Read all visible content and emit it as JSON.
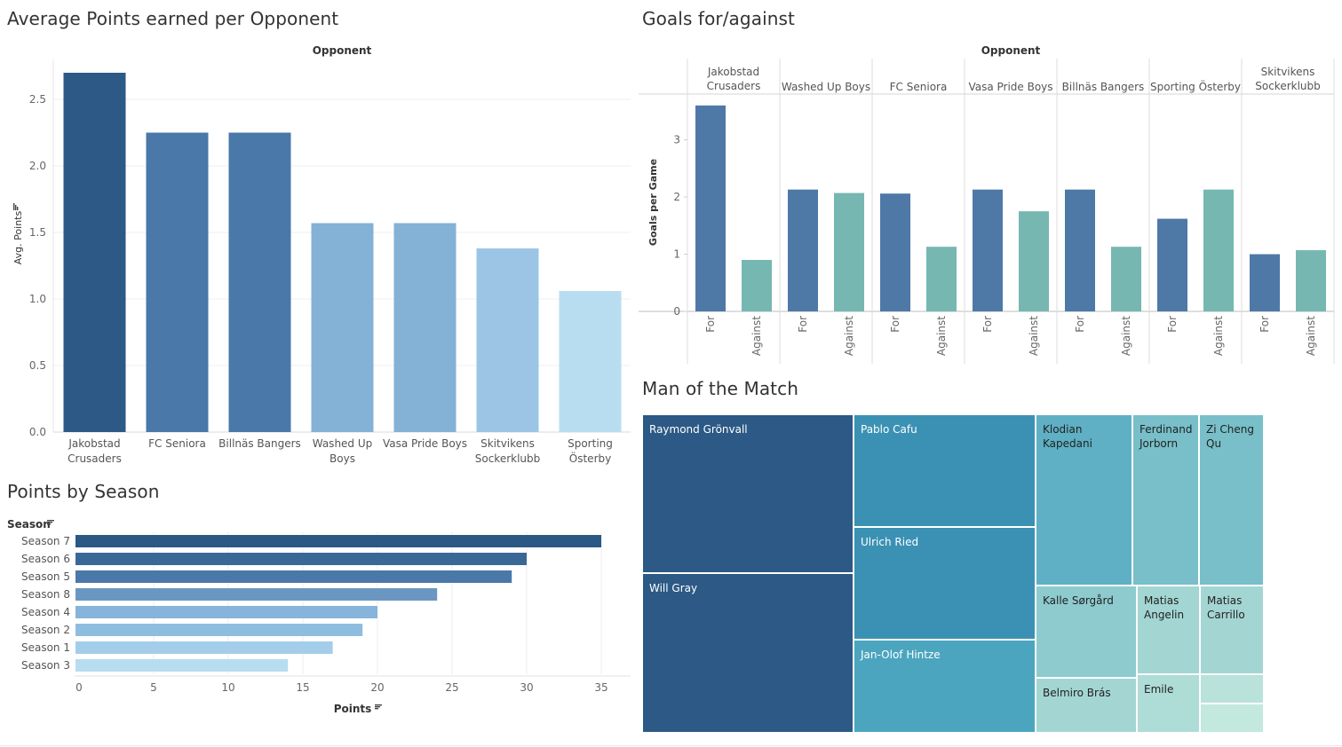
{
  "titles": {
    "avg_points": "Average Points earned per Opponent",
    "goals": "Goals for/against",
    "season": "Points by Season",
    "motm": "Man of the Match"
  },
  "icons": {
    "sort": "sort-descending-icon"
  },
  "chart_data": [
    {
      "type": "bar",
      "name": "avg-points",
      "header": "Opponent",
      "ylabel": "Avg. Points",
      "categories": [
        [
          "Jakobstad",
          "Crusaders"
        ],
        [
          "FC Seniora"
        ],
        [
          "Billnäs Bangers"
        ],
        [
          "Washed Up",
          "Boys"
        ],
        [
          "Vasa Pride Boys"
        ],
        [
          "Skitvikens",
          "Sockerklubb"
        ],
        [
          "Sporting",
          "Österby"
        ]
      ],
      "values": [
        2.7,
        2.25,
        2.25,
        1.57,
        1.57,
        1.38,
        1.06
      ],
      "colors": [
        "#2c5985",
        "#4a78a8",
        "#4a78a8",
        "#84b1d6",
        "#84b1d6",
        "#9cc5e5",
        "#b9ddf0"
      ],
      "ylim": [
        0,
        2.8
      ],
      "yticks": [
        "0.0",
        "0.5",
        "1.0",
        "1.5",
        "2.0",
        "2.5"
      ]
    },
    {
      "type": "bar",
      "name": "goals-for-against",
      "header": "Opponent",
      "ylabel": "Goals per Game",
      "groups": [
        [
          "Jakobstad",
          "Crusaders"
        ],
        [
          "Washed Up Boys"
        ],
        [
          "FC Seniora"
        ],
        [
          "Vasa Pride Boys"
        ],
        [
          "Billnäs Bangers"
        ],
        [
          "Sporting Österby"
        ],
        [
          "Skitvikens",
          "Sockerklubb"
        ]
      ],
      "bar_labels": [
        "For",
        "Against"
      ],
      "series": [
        {
          "name": "For",
          "color": "#4e79a7",
          "values": [
            3.6,
            2.13,
            2.06,
            2.13,
            2.13,
            1.62,
            1.0
          ]
        },
        {
          "name": "Against",
          "color": "#76b7b2",
          "values": [
            0.9,
            2.07,
            1.13,
            1.75,
            1.13,
            2.13,
            1.07
          ]
        }
      ],
      "ylim": [
        0,
        3.8
      ],
      "yticks": [
        "0",
        "1",
        "2",
        "3"
      ]
    },
    {
      "type": "bar",
      "name": "points-by-season",
      "orientation": "horizontal",
      "ylabel": "Season",
      "xlabel": "Points",
      "categories": [
        "Season 7",
        "Season 6",
        "Season 5",
        "Season 8",
        "Season 4",
        "Season 2",
        "Season 1",
        "Season 3"
      ],
      "values": [
        35,
        30,
        29,
        24,
        20,
        19,
        17,
        14
      ],
      "colors": [
        "#2b5884",
        "#3a6896",
        "#4a78a8",
        "#6a97c1",
        "#86b4da",
        "#8fbde0",
        "#a4cdea",
        "#b8dcf0"
      ],
      "xlim": [
        0,
        37
      ],
      "xticks": [
        "0",
        "5",
        "10",
        "15",
        "20",
        "25",
        "30",
        "35"
      ]
    },
    {
      "type": "treemap",
      "name": "man-of-the-match",
      "cells": [
        {
          "label": "Raymond Grönvall",
          "color": "#2c5985"
        },
        {
          "label": "Will Gray",
          "color": "#2c5985"
        },
        {
          "label": "Pablo Cafu",
          "color": "#3b91b3"
        },
        {
          "label": "Ulrich Ried",
          "color": "#3b91b3"
        },
        {
          "label": "Jan-Olof Hintze",
          "color": "#4ba5bf"
        },
        {
          "label": "Klodian Kapedani",
          "color": "#5fb0c4"
        },
        {
          "label": "Ferdinand Jorborn",
          "color": "#78bfc9"
        },
        {
          "label": "Zi Cheng Qu",
          "color": "#78bfc9"
        },
        {
          "label": "Kalle Sørgård",
          "color": "#8ecbcf"
        },
        {
          "label": "Matias Angelin",
          "color": "#a3d6d3"
        },
        {
          "label": "Matias Carrillo",
          "color": "#a3d6d3"
        },
        {
          "label": "Belmiro Brás",
          "color": "#a3d6d3"
        },
        {
          "label": "Emile",
          "color": "#aedcd7"
        },
        {
          "label": "",
          "color": "#b9e2da"
        },
        {
          "label": "",
          "color": "#c3e8dd"
        }
      ]
    }
  ]
}
